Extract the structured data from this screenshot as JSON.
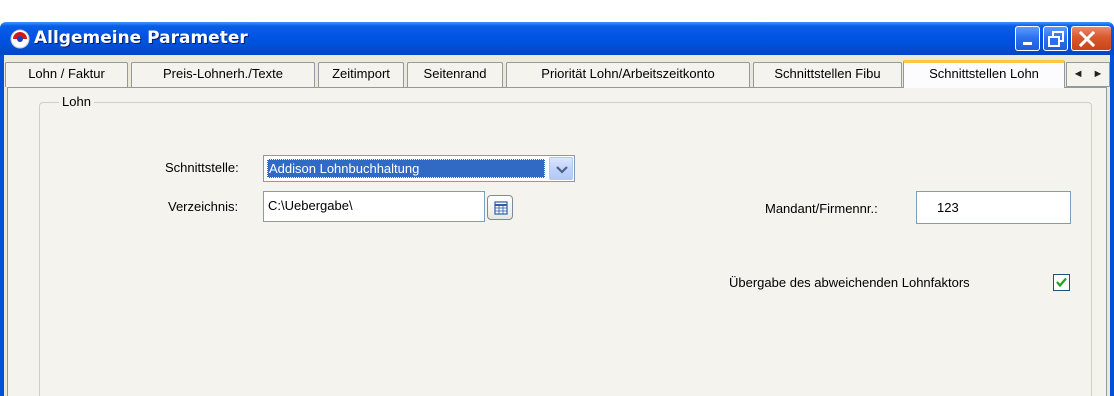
{
  "window": {
    "title": "Allgemeine Parameter",
    "icon": "app-shield-icon",
    "controls": [
      "minimize-icon",
      "maximize-icon",
      "close-icon"
    ]
  },
  "tabs": [
    {
      "label": "Lohn / Faktur",
      "active": false
    },
    {
      "label": "Preis-Lohnerh./Texte",
      "active": false
    },
    {
      "label": "Zeitimport",
      "active": false
    },
    {
      "label": "Seitenrand",
      "active": false
    },
    {
      "label": "Priorität Lohn/Arbeitszeitkonto",
      "active": false
    },
    {
      "label": "Schnittstellen Fibu",
      "active": false
    },
    {
      "label": "Schnittstellen Lohn",
      "active": true
    }
  ],
  "tab_scroll": {
    "left": "◄",
    "right": "►"
  },
  "group": {
    "title": "Lohn",
    "schnittstelle_label": "Schnittstelle:",
    "schnittstelle_value": "Addison Lohnbuchhaltung",
    "verzeichnis_label": "Verzeichnis:",
    "verzeichnis_value": "C:\\Uebergabe\\",
    "mandant_label": "Mandant/Firmennr.:",
    "mandant_value": "123",
    "checkbox_label": "Übergabe des abweichenden Lohnfaktors",
    "checkbox_checked": true
  },
  "colors": {
    "titlebar": "#0054e3",
    "selection": "#316ac5",
    "dialog_bg": "#ece9d8",
    "tab_page_bg": "#f4f3ee",
    "active_tab_accent": "#ffc83c",
    "checkmark": "#21a121"
  }
}
